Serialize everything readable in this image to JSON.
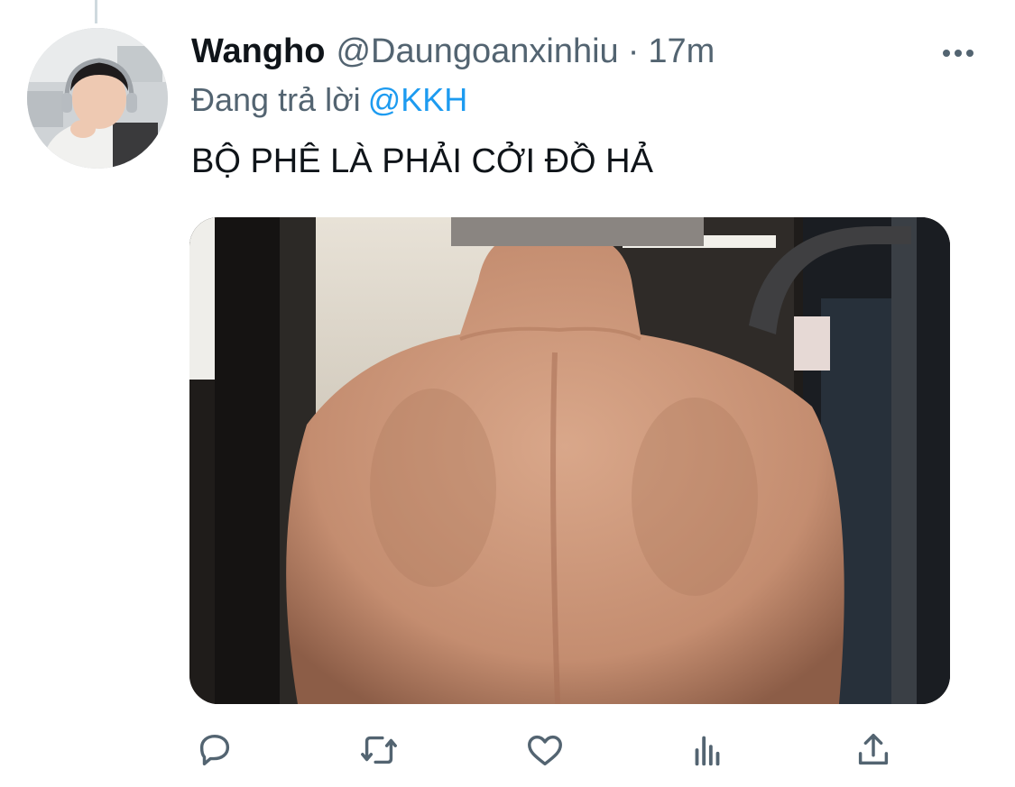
{
  "tweet": {
    "display_name": "Wangho",
    "handle": "@Daungoanxinhiu",
    "separator": "·",
    "time": "17m",
    "reply_prefix": "Đang trả lời",
    "reply_to": "@KKH",
    "text": "BỘ PHÊ LÀ PHẢI CỞI ĐỒ HẢ"
  },
  "actions": {
    "reply_icon": "reply-icon",
    "retweet_icon": "retweet-icon",
    "like_icon": "like-icon",
    "analytics_icon": "analytics-icon",
    "share_icon": "share-icon"
  },
  "colors": {
    "primary_text": "#0f1419",
    "secondary_text": "#536471",
    "link": "#1d9bf0",
    "thread_line": "#cfd9de"
  }
}
